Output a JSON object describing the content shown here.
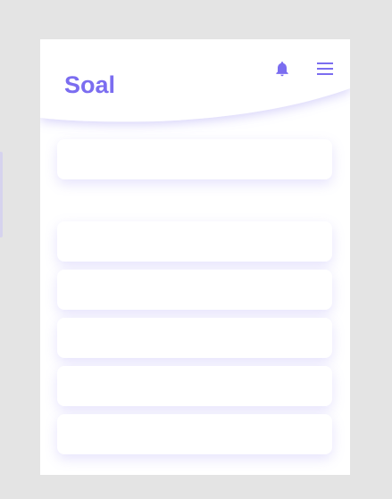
{
  "app": {
    "title": "Soal"
  },
  "header": {
    "icons": [
      "bell-icon",
      "menu-icon"
    ]
  },
  "search_card": {
    "text": ""
  },
  "question_items": [
    {
      "text": ""
    },
    {
      "text": ""
    },
    {
      "text": ""
    },
    {
      "text": ""
    },
    {
      "text": ""
    }
  ],
  "colors": {
    "accent": "#7b6df0",
    "background": "#e4e4e4",
    "card": "#ffffff"
  }
}
